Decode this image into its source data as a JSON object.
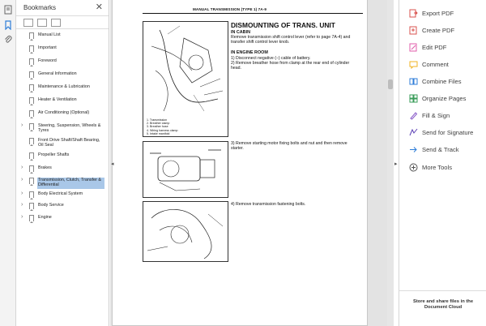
{
  "bookmarks_panel": {
    "title": "Bookmarks",
    "close": "✕",
    "items": [
      {
        "label": "Manual List",
        "expandable": false
      },
      {
        "label": "Important",
        "expandable": false
      },
      {
        "label": "Foreword",
        "expandable": false
      },
      {
        "label": "General Information",
        "expandable": false
      },
      {
        "label": "Maintenance & Lubrication",
        "expandable": false
      },
      {
        "label": "Heater & Ventilation",
        "expandable": false
      },
      {
        "label": "Air Conditioning (Optional)",
        "expandable": false
      },
      {
        "label": "Steering, Suspension, Wheels & Tyres",
        "expandable": true
      },
      {
        "label": "Front Drive Shaft/Shaft Bearing, Oil Seal",
        "expandable": false
      },
      {
        "label": "Propeller Shafts",
        "expandable": false
      },
      {
        "label": "Brakes",
        "expandable": true
      },
      {
        "label": "Transmission, Clutch, Transfer & Differential",
        "expandable": true,
        "selected": true
      },
      {
        "label": "Body Electrical System",
        "expandable": true
      },
      {
        "label": "Body Service",
        "expandable": true
      },
      {
        "label": "Engine",
        "expandable": true
      }
    ]
  },
  "document": {
    "header": "MANUAL TRANSMISSION (TYPE 1)   7A-9",
    "heading": "DISMOUNTING OF TRANS. UNIT",
    "sub1": "IN CABIN",
    "p1": "Remove transmission shift control lever (refer to page 7A-4) and transfer shift control lever knob.",
    "sub2": "IN ENGINE ROOM",
    "p2": "1)  Disconnect negative (–) cable of battery.",
    "p3": "2)  Remove breather hose from clamp at the rear end of cylinder head.",
    "p4": "3)  Remove starting motor fixing bolts and nut and then remove starter.",
    "p5": "4)  Remove transmission fastening bolts.",
    "legend": [
      "1. Transmission",
      "2. Breather clamp",
      "3. Breather hose",
      "4. Wiring harness clamp",
      "5. Intake manifold"
    ]
  },
  "tools_panel": {
    "items": [
      {
        "label": "Export PDF",
        "icon": "export-pdf-icon",
        "color": "#d9534f"
      },
      {
        "label": "Create PDF",
        "icon": "create-pdf-icon",
        "color": "#d9534f"
      },
      {
        "label": "Edit PDF",
        "icon": "edit-pdf-icon",
        "color": "#e05cab"
      },
      {
        "label": "Comment",
        "icon": "comment-icon",
        "color": "#f0b323"
      },
      {
        "label": "Combine Files",
        "icon": "combine-files-icon",
        "color": "#2f7ed8"
      },
      {
        "label": "Organize Pages",
        "icon": "organize-pages-icon",
        "color": "#3a9c5a"
      },
      {
        "label": "Fill & Sign",
        "icon": "fill-sign-icon",
        "color": "#8657c7"
      },
      {
        "label": "Send for Signature",
        "icon": "send-signature-icon",
        "color": "#5b3fb5"
      },
      {
        "label": "Send & Track",
        "icon": "send-track-icon",
        "color": "#2f7ed8"
      },
      {
        "label": "More Tools",
        "icon": "more-tools-icon",
        "color": "#555555"
      }
    ],
    "footer": "Store and share files in the Document Cloud"
  }
}
